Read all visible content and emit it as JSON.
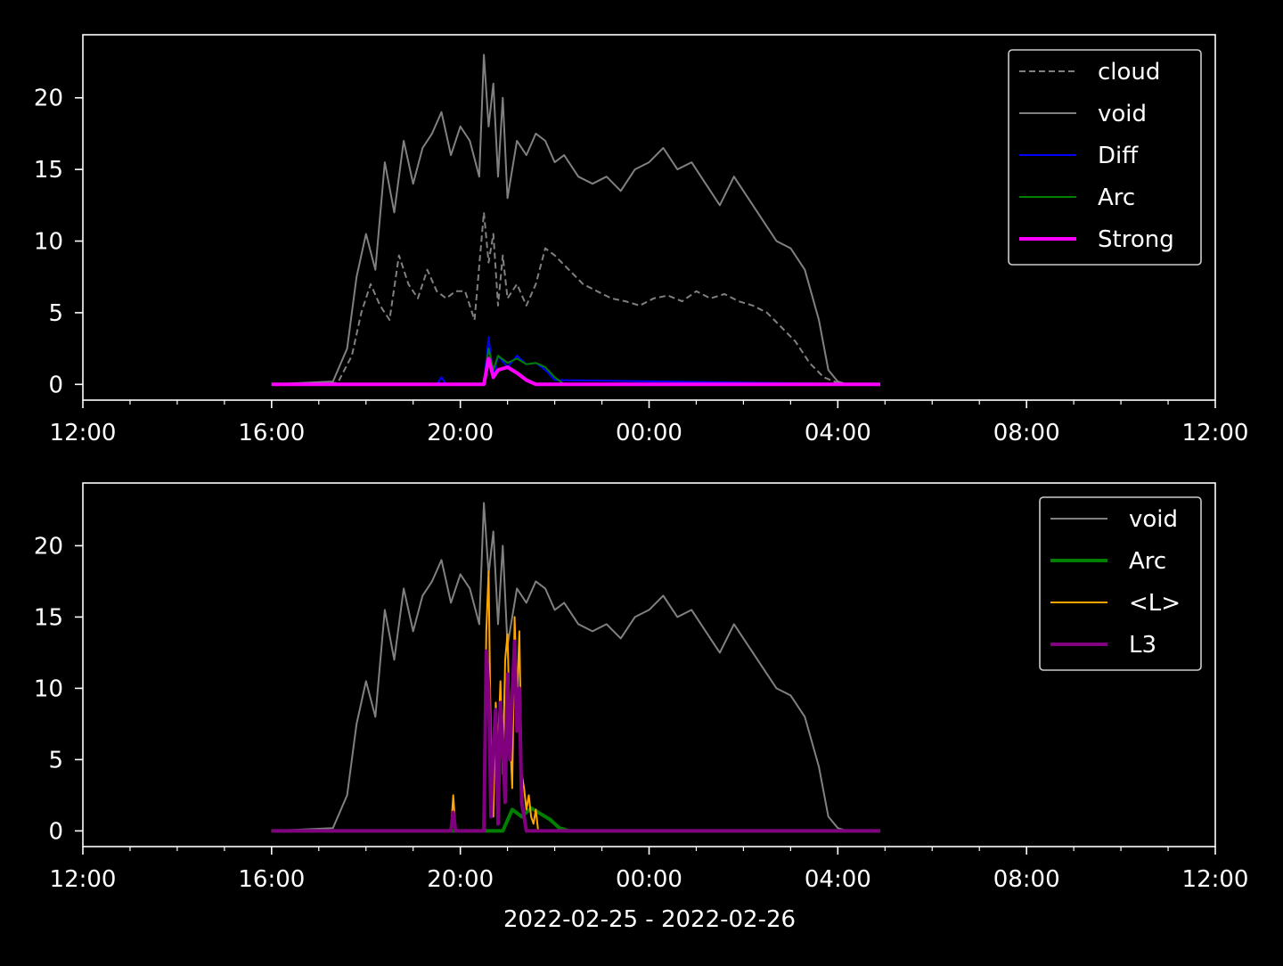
{
  "figure": {
    "background": "#000000",
    "foreground": "#ffffff",
    "xlabel": "2022-02-25 - 2022-02-26"
  },
  "chart_data": [
    {
      "type": "line",
      "x_unit": "hours after 2022-02-25 12:00",
      "xlim": [
        0,
        24
      ],
      "ylim": [
        -1.1,
        24.4
      ],
      "xticks": [
        {
          "x": 0,
          "label": "12:00"
        },
        {
          "x": 4,
          "label": "16:00"
        },
        {
          "x": 8,
          "label": "20:00"
        },
        {
          "x": 12,
          "label": "00:00"
        },
        {
          "x": 16,
          "label": "04:00"
        },
        {
          "x": 20,
          "label": "08:00"
        },
        {
          "x": 24,
          "label": "12:00"
        }
      ],
      "yticks": [
        0,
        5,
        10,
        15,
        20
      ],
      "legend_position": "top-right",
      "series": [
        {
          "name": "cloud",
          "color": "#808080",
          "style": "dashed",
          "width": 2,
          "x": [
            4.0,
            5.4,
            5.7,
            5.9,
            6.1,
            6.3,
            6.5,
            6.7,
            6.9,
            7.1,
            7.3,
            7.5,
            7.7,
            7.9,
            8.1,
            8.3,
            8.5,
            8.6,
            8.7,
            8.8,
            8.9,
            9.0,
            9.2,
            9.4,
            9.6,
            9.8,
            10.0,
            10.3,
            10.6,
            10.9,
            11.2,
            11.5,
            11.8,
            12.1,
            12.4,
            12.7,
            13.0,
            13.3,
            13.6,
            13.9,
            14.2,
            14.5,
            14.8,
            15.1,
            15.4,
            15.7,
            16.0,
            16.3,
            16.6,
            16.9
          ],
          "y": [
            0.0,
            0.1,
            2.0,
            5.0,
            7.0,
            5.5,
            4.5,
            9.0,
            7.0,
            6.0,
            8.0,
            6.5,
            6.0,
            6.5,
            6.5,
            4.5,
            12.0,
            8.5,
            10.5,
            5.5,
            9.0,
            6.0,
            7.0,
            5.5,
            7.0,
            9.5,
            9.0,
            8.0,
            7.0,
            6.5,
            6.0,
            5.8,
            5.5,
            6.0,
            6.2,
            5.8,
            6.5,
            6.0,
            6.3,
            5.8,
            5.5,
            5.0,
            4.0,
            3.0,
            1.5,
            0.5,
            0.1,
            0.0,
            0.0,
            0.0
          ]
        },
        {
          "name": "void",
          "color": "#808080",
          "style": "solid",
          "width": 2,
          "x": [
            4.0,
            5.3,
            5.6,
            5.8,
            6.0,
            6.2,
            6.4,
            6.6,
            6.8,
            7.0,
            7.2,
            7.4,
            7.6,
            7.8,
            8.0,
            8.2,
            8.4,
            8.5,
            8.6,
            8.7,
            8.8,
            8.9,
            9.0,
            9.2,
            9.4,
            9.6,
            9.8,
            10.0,
            10.2,
            10.5,
            10.8,
            11.1,
            11.4,
            11.7,
            12.0,
            12.3,
            12.6,
            12.9,
            13.2,
            13.5,
            13.8,
            14.1,
            14.4,
            14.7,
            15.0,
            15.3,
            15.6,
            15.8,
            16.0,
            16.2,
            16.5,
            16.9
          ],
          "y": [
            0.0,
            0.2,
            2.5,
            7.5,
            10.5,
            8.0,
            15.5,
            12.0,
            17.0,
            14.0,
            16.5,
            17.5,
            19.0,
            16.0,
            18.0,
            17.0,
            14.5,
            23.0,
            18.0,
            21.0,
            14.5,
            20.0,
            13.0,
            17.0,
            16.0,
            17.5,
            17.0,
            15.5,
            16.0,
            14.5,
            14.0,
            14.5,
            13.5,
            15.0,
            15.5,
            16.5,
            15.0,
            15.5,
            14.0,
            12.5,
            14.5,
            13.0,
            11.5,
            10.0,
            9.5,
            8.0,
            4.5,
            1.0,
            0.2,
            0.0,
            0.0,
            0.0
          ]
        },
        {
          "name": "Diff",
          "color": "#0000ff",
          "style": "solid",
          "width": 2,
          "x": [
            4.0,
            7.5,
            7.6,
            7.7,
            8.5,
            8.6,
            8.7,
            8.8,
            9.0,
            9.2,
            9.4,
            9.6,
            9.8,
            10.0,
            16.9
          ],
          "y": [
            0.0,
            0.0,
            0.5,
            0.0,
            0.0,
            3.3,
            0.5,
            2.0,
            1.2,
            2.0,
            1.4,
            1.5,
            1.0,
            0.3,
            0.0
          ]
        },
        {
          "name": "Arc",
          "color": "#008000",
          "style": "solid",
          "width": 2,
          "x": [
            4.0,
            8.5,
            8.6,
            8.7,
            8.8,
            9.0,
            9.2,
            9.4,
            9.6,
            9.8,
            10.0,
            10.2,
            16.9
          ],
          "y": [
            0.0,
            0.0,
            2.5,
            1.0,
            2.0,
            1.5,
            1.8,
            1.4,
            1.5,
            1.2,
            0.5,
            0.0,
            0.0
          ]
        },
        {
          "name": "Strong",
          "color": "#ff00ff",
          "style": "solid",
          "width": 4,
          "x": [
            4.0,
            8.5,
            8.6,
            8.7,
            8.8,
            9.0,
            9.2,
            9.4,
            9.6,
            16.9
          ],
          "y": [
            0.0,
            0.0,
            1.8,
            0.5,
            1.0,
            1.2,
            0.8,
            0.3,
            0.0,
            0.0
          ]
        }
      ]
    },
    {
      "type": "line",
      "x_unit": "hours after 2022-02-25 12:00",
      "xlim": [
        0,
        24
      ],
      "ylim": [
        -1.1,
        24.4
      ],
      "xticks": [
        {
          "x": 0,
          "label": "12:00"
        },
        {
          "x": 4,
          "label": "16:00"
        },
        {
          "x": 8,
          "label": "20:00"
        },
        {
          "x": 12,
          "label": "00:00"
        },
        {
          "x": 16,
          "label": "04:00"
        },
        {
          "x": 20,
          "label": "08:00"
        },
        {
          "x": 24,
          "label": "12:00"
        }
      ],
      "yticks": [
        0,
        5,
        10,
        15,
        20
      ],
      "legend_position": "top-right",
      "series": [
        {
          "name": "void",
          "color": "#808080",
          "style": "solid",
          "width": 2,
          "x": [
            4.0,
            5.3,
            5.6,
            5.8,
            6.0,
            6.2,
            6.4,
            6.6,
            6.8,
            7.0,
            7.2,
            7.4,
            7.6,
            7.8,
            8.0,
            8.2,
            8.4,
            8.5,
            8.6,
            8.7,
            8.8,
            8.9,
            9.0,
            9.2,
            9.4,
            9.6,
            9.8,
            10.0,
            10.2,
            10.5,
            10.8,
            11.1,
            11.4,
            11.7,
            12.0,
            12.3,
            12.6,
            12.9,
            13.2,
            13.5,
            13.8,
            14.1,
            14.4,
            14.7,
            15.0,
            15.3,
            15.6,
            15.8,
            16.0,
            16.2,
            16.5,
            16.9
          ],
          "y": [
            0.0,
            0.2,
            2.5,
            7.5,
            10.5,
            8.0,
            15.5,
            12.0,
            17.0,
            14.0,
            16.5,
            17.5,
            19.0,
            16.0,
            18.0,
            17.0,
            14.5,
            23.0,
            18.0,
            21.0,
            14.5,
            20.0,
            13.0,
            17.0,
            16.0,
            17.5,
            17.0,
            15.5,
            16.0,
            14.5,
            14.0,
            14.5,
            13.5,
            15.0,
            15.5,
            16.5,
            15.0,
            15.5,
            14.0,
            12.5,
            14.5,
            13.0,
            11.5,
            10.0,
            9.5,
            8.0,
            4.5,
            1.0,
            0.2,
            0.0,
            0.0,
            0.0
          ]
        },
        {
          "name": "Arc",
          "color": "#008000",
          "style": "solid",
          "width": 4,
          "x": [
            4.0,
            8.9,
            9.1,
            9.3,
            9.5,
            9.7,
            9.9,
            10.1,
            10.3,
            16.9
          ],
          "y": [
            0.0,
            0.0,
            1.5,
            1.0,
            1.6,
            1.2,
            0.8,
            0.2,
            0.0,
            0.0
          ]
        },
        {
          "name": "<L>",
          "color": "#ffa500",
          "style": "solid",
          "width": 2,
          "x": [
            4.0,
            7.8,
            7.85,
            7.9,
            8.5,
            8.55,
            8.6,
            8.65,
            8.7,
            8.75,
            8.8,
            8.85,
            8.9,
            8.95,
            9.0,
            9.05,
            9.1,
            9.15,
            9.2,
            9.25,
            9.3,
            9.35,
            9.4,
            9.45,
            9.5,
            9.55,
            9.6,
            9.65,
            16.9
          ],
          "y": [
            0.0,
            0.0,
            2.5,
            0.0,
            0.0,
            14.0,
            18.2,
            5.0,
            1.0,
            9.0,
            6.0,
            10.5,
            4.0,
            12.0,
            13.8,
            7.0,
            3.0,
            15.0,
            9.0,
            14.0,
            4.0,
            3.0,
            1.5,
            2.5,
            1.0,
            0.5,
            1.5,
            0.0,
            0.0
          ]
        },
        {
          "name": "L3",
          "color": "#800080",
          "style": "solid",
          "width": 4,
          "x": [
            4.0,
            7.8,
            7.85,
            7.9,
            8.5,
            8.55,
            8.6,
            8.65,
            8.7,
            8.75,
            8.8,
            8.85,
            8.9,
            8.95,
            9.0,
            9.05,
            9.1,
            9.15,
            9.2,
            9.25,
            9.3,
            9.35,
            9.4,
            9.5,
            16.9
          ],
          "y": [
            0.0,
            0.0,
            1.3,
            0.0,
            0.0,
            12.6,
            10.0,
            1.0,
            6.0,
            8.5,
            0.5,
            9.0,
            6.0,
            2.0,
            11.0,
            5.0,
            9.5,
            13.3,
            7.0,
            10.0,
            2.0,
            1.0,
            0.0,
            0.0,
            0.0
          ]
        }
      ]
    }
  ]
}
